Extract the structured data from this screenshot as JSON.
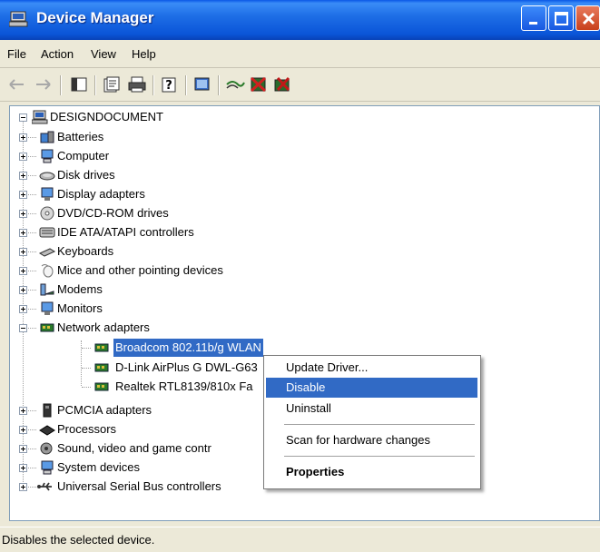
{
  "window": {
    "title": "Device Manager"
  },
  "menu": [
    "File",
    "Action",
    "View",
    "Help"
  ],
  "toolbar": [
    "back-arrow-icon",
    "forward-arrow-icon",
    "show-hide-console-tree-icon",
    "properties-icon",
    "print-icon",
    "help-icon",
    "scan-hardware-icon",
    "update-driver-icon",
    "uninstall-icon",
    "disable-icon"
  ],
  "tree": {
    "root": "DESIGNDOCUMENT",
    "categories": [
      "Batteries",
      "Computer",
      "Disk drives",
      "Display adapters",
      "DVD/CD-ROM drives",
      "IDE ATA/ATAPI controllers",
      "Keyboards",
      "Mice and other pointing devices",
      "Modems",
      "Monitors",
      "Network adapters"
    ],
    "network_children": [
      "Broadcom 802.11b/g WLAN",
      "D-Link AirPlus G DWL-G63",
      "Realtek RTL8139/810x Fa"
    ],
    "categories_after": [
      "PCMCIA adapters",
      "Processors",
      "Sound, video and game contr",
      "System devices",
      "Universal Serial Bus controllers"
    ]
  },
  "context_menu": {
    "items": [
      "Update Driver...",
      "Disable",
      "Uninstall",
      "Scan for hardware changes",
      "Properties"
    ],
    "highlighted": "Disable"
  },
  "status": "Disables the selected device.",
  "colors": {
    "selection": "#316ac5",
    "titlebar": "#0a55d8"
  }
}
